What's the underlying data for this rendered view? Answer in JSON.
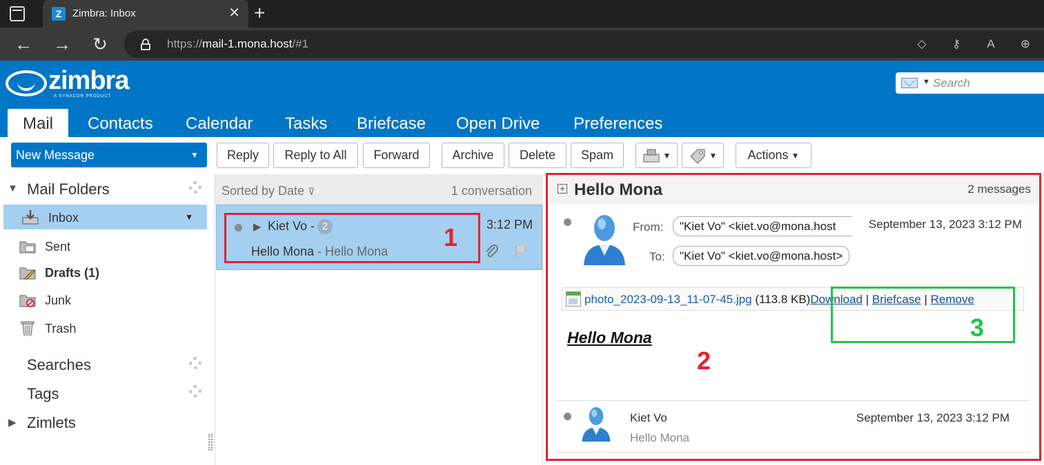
{
  "browser": {
    "tab_title": "Zimbra: Inbox",
    "favicon_letter": "Z",
    "url_scheme": "https://",
    "url_host": "mail-1.mona.host",
    "url_path": "/#1"
  },
  "header": {
    "logo_text": "zimbra",
    "logo_subtext": "A SYNACOR PRODUCT",
    "search_placeholder": "Search",
    "tabs": [
      {
        "label": "Mail",
        "active": true
      },
      {
        "label": "Contacts"
      },
      {
        "label": "Calendar"
      },
      {
        "label": "Tasks"
      },
      {
        "label": "Briefcase"
      },
      {
        "label": "Open Drive"
      },
      {
        "label": "Preferences"
      }
    ]
  },
  "toolbar": {
    "new_message": "New Message",
    "reply": "Reply",
    "reply_all": "Reply to All",
    "forward": "Forward",
    "archive": "Archive",
    "delete": "Delete",
    "spam": "Spam",
    "actions": "Actions"
  },
  "sidebar": {
    "mail_folders": "Mail Folders",
    "folders": [
      {
        "label": "Inbox",
        "icon": "inbox-icon",
        "selected": true
      },
      {
        "label": "Sent",
        "icon": "sent-folder-icon"
      },
      {
        "label": "Drafts (1)",
        "icon": "drafts-folder-icon",
        "bold": true
      },
      {
        "label": "Junk",
        "icon": "junk-folder-icon"
      },
      {
        "label": "Trash",
        "icon": "trash-icon"
      }
    ],
    "searches": "Searches",
    "tags": "Tags",
    "zimlets": "Zimlets"
  },
  "list": {
    "sort_label": "Sorted by Date",
    "count_label": "1 conversation",
    "conversation": {
      "sender": "Kiet Vo -",
      "count": "2",
      "time": "3:12 PM",
      "subject": "Hello Mona",
      "fragment": "- Hello Mona"
    }
  },
  "reading": {
    "subject": "Hello Mona",
    "message_count": "2 messages",
    "from_label": "From:",
    "from_value": "\"Kiet Vo\" <kiet.vo@mona.host",
    "to_label": "To:",
    "to_value": "\"Kiet Vo\" <kiet.vo@mona.host>",
    "date": "September 13, 2023 3:12 PM",
    "attachment": {
      "filename": "photo_2023-09-13_11-07-45.jpg",
      "size": "(113.8 KB)",
      "download": "Download",
      "sep": "|",
      "briefcase": "Briefcase",
      "remove": "Remove"
    },
    "body_text": "Hello Mona",
    "second_message": {
      "sender": "Kiet Vo",
      "snippet": "Hello Mona",
      "date": "September 13, 2023 3:12 PM"
    }
  },
  "annotations": {
    "box1": "1",
    "box2": "2",
    "box3": "3",
    "red_color": "#e0242c",
    "green_color": "#22c548"
  },
  "colors": {
    "brand": "#0276c6",
    "selection": "#a5cff0"
  }
}
